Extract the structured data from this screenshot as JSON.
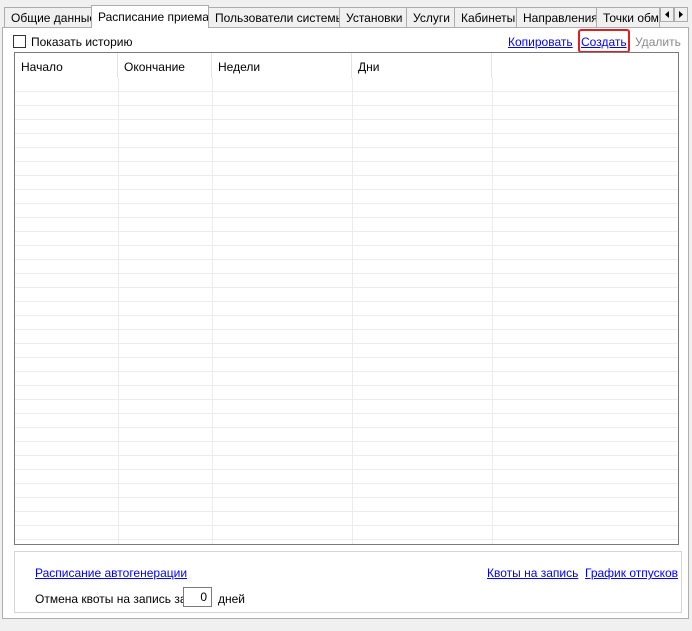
{
  "tabs": [
    {
      "label": "Общие данные",
      "active": false
    },
    {
      "label": "Расписание приема",
      "active": true
    },
    {
      "label": "Пользователи системы",
      "active": false
    },
    {
      "label": "Установки",
      "active": false
    },
    {
      "label": "Услуги",
      "active": false
    },
    {
      "label": "Кабинеты",
      "active": false
    },
    {
      "label": "Направления",
      "active": false
    },
    {
      "label": "Точки обм",
      "active": false
    }
  ],
  "toolbar": {
    "show_history_label": "Показать историю",
    "show_history_checked": false,
    "copy_label": "Копировать",
    "create_label": "Создать",
    "delete_label": "Удалить",
    "highlight_color": "#e02020"
  },
  "grid": {
    "columns": [
      "Начало",
      "Окончание",
      "Недели",
      "Дни",
      ""
    ],
    "rows": []
  },
  "bottom": {
    "autogen_link": "Расписание автогенерации",
    "quota_link": "Квоты на запись",
    "vacation_link": "График отпусков",
    "cancel_quota_label": "Отмена квоты на запись за",
    "cancel_quota_value": "0",
    "cancel_quota_unit": "дней"
  },
  "colors": {
    "link": "#0000ff",
    "disabled": "#8a8a8a",
    "window_bg": "#f0f0f0"
  }
}
